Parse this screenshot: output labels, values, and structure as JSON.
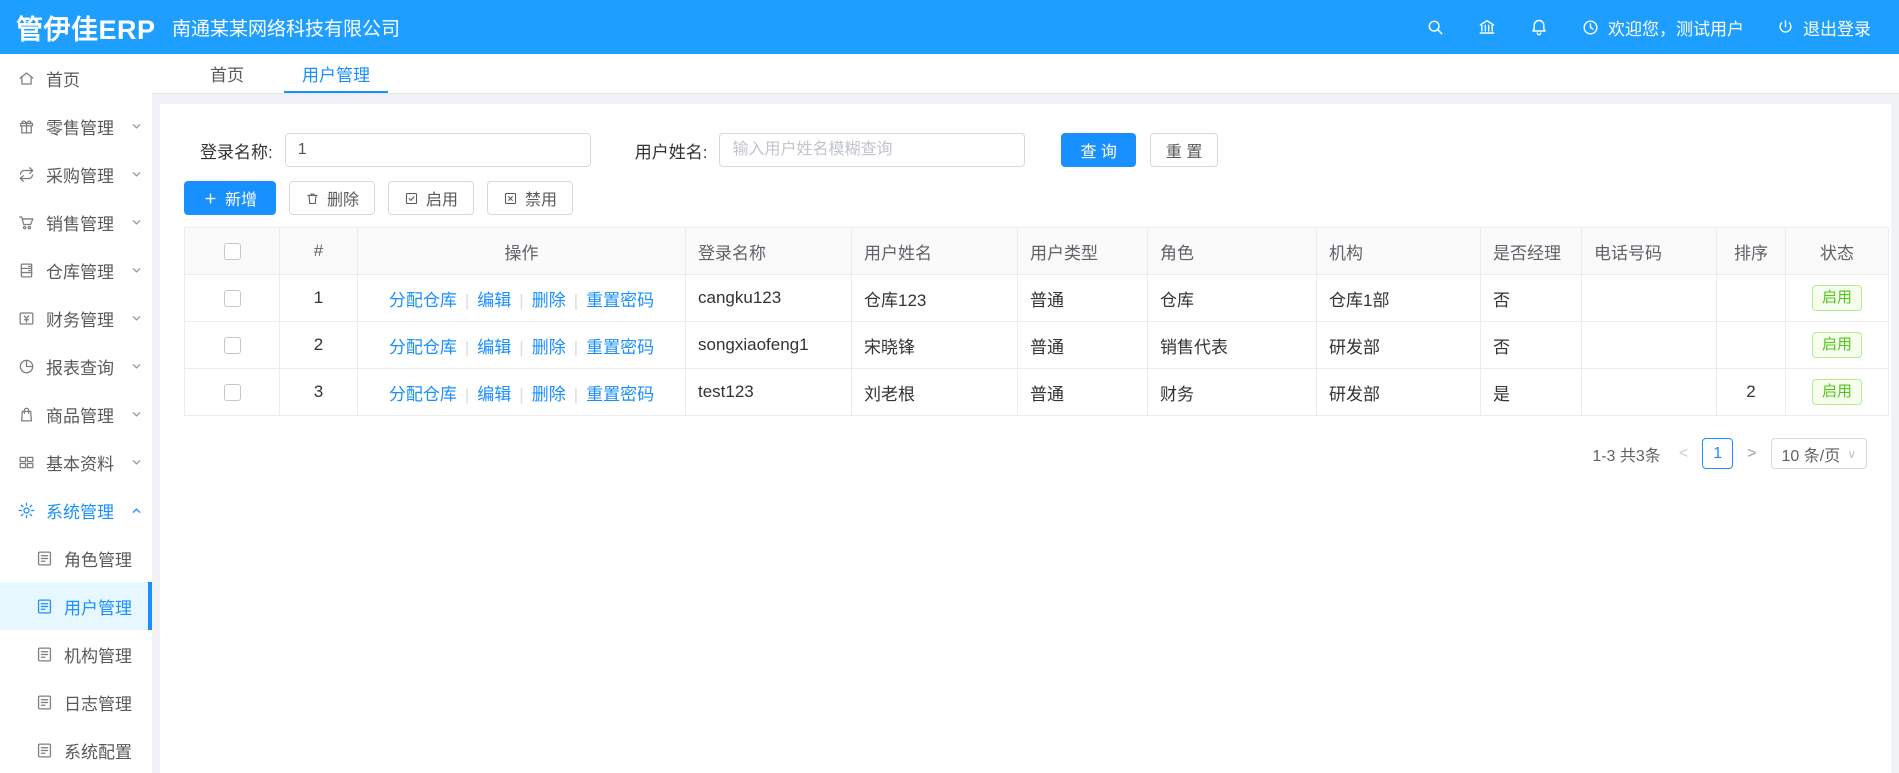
{
  "colors": {
    "header_bg": "#1e9fff",
    "primary": "#1890ff",
    "status_green": "#52c41a",
    "active_menu_bg": "#e6f7ff"
  },
  "header": {
    "logo": "管伊佳ERP",
    "company": "南通某某网络科技有限公司",
    "welcome_text": "欢迎您，测试用户",
    "logout_text": "退出登录",
    "icons": [
      "search-icon",
      "bank-icon",
      "bell-icon",
      "clock-icon",
      "logout-icon"
    ]
  },
  "sidebar": {
    "items": [
      {
        "id": "home",
        "label": "首页",
        "icon": "home-icon",
        "expandable": false
      },
      {
        "id": "retail",
        "label": "零售管理",
        "icon": "gift-icon",
        "expandable": true
      },
      {
        "id": "purchase",
        "label": "采购管理",
        "icon": "exchange-icon",
        "expandable": true
      },
      {
        "id": "sales",
        "label": "销售管理",
        "icon": "cart-icon",
        "expandable": true
      },
      {
        "id": "warehouse",
        "label": "仓库管理",
        "icon": "cabinet-icon",
        "expandable": true
      },
      {
        "id": "finance",
        "label": "财务管理",
        "icon": "money-icon",
        "expandable": true
      },
      {
        "id": "reports",
        "label": "报表查询",
        "icon": "pie-chart-icon",
        "expandable": true
      },
      {
        "id": "goods",
        "label": "商品管理",
        "icon": "bag-icon",
        "expandable": true
      },
      {
        "id": "basedata",
        "label": "基本资料",
        "icon": "grid-icon",
        "expandable": true
      },
      {
        "id": "system",
        "label": "系统管理",
        "icon": "gear-icon",
        "expandable": true,
        "expanded": true,
        "active": true,
        "children": [
          {
            "id": "roles",
            "label": "角色管理",
            "icon": "list-icon",
            "active": false
          },
          {
            "id": "users",
            "label": "用户管理",
            "icon": "list-icon",
            "active": true
          },
          {
            "id": "orgs",
            "label": "机构管理",
            "icon": "list-icon",
            "active": false
          },
          {
            "id": "logs",
            "label": "日志管理",
            "icon": "list-icon",
            "active": false
          },
          {
            "id": "config",
            "label": "系统配置",
            "icon": "list-icon",
            "active": false
          }
        ]
      }
    ]
  },
  "tabs": [
    {
      "label": "首页",
      "active": false
    },
    {
      "label": "用户管理",
      "active": true
    }
  ],
  "search": {
    "login_label": "登录名称:",
    "login_value": "1",
    "name_label": "用户姓名:",
    "name_placeholder": "输入用户姓名模糊查询",
    "query_button": "查 询",
    "reset_button": "重 置"
  },
  "toolbar": {
    "add": "新增",
    "delete": "删除",
    "enable": "启用",
    "disable": "禁用"
  },
  "table": {
    "headers": [
      "#",
      "操作",
      "登录名称",
      "用户姓名",
      "用户类型",
      "角色",
      "机构",
      "是否经理",
      "电话号码",
      "排序",
      "状态"
    ],
    "action_links": [
      "分配仓库",
      "编辑",
      "删除",
      "重置密码"
    ],
    "rows": [
      {
        "index": "1",
        "login": "cangku123",
        "name": "仓库123",
        "type": "普通",
        "role": "仓库",
        "org": "仓库1部",
        "manager": "否",
        "phone": "",
        "sort": "",
        "status": "启用"
      },
      {
        "index": "2",
        "login": "songxiaofeng1",
        "name": "宋晓锋",
        "type": "普通",
        "role": "销售代表",
        "org": "研发部",
        "manager": "否",
        "phone": "",
        "sort": "",
        "status": "启用"
      },
      {
        "index": "3",
        "login": "test123",
        "name": "刘老根",
        "type": "普通",
        "role": "财务",
        "org": "研发部",
        "manager": "是",
        "phone": "",
        "sort": "2",
        "status": "启用"
      }
    ]
  },
  "pagination": {
    "total": "1-3 共3条",
    "current_page": "1",
    "page_size": "10 条/页"
  }
}
